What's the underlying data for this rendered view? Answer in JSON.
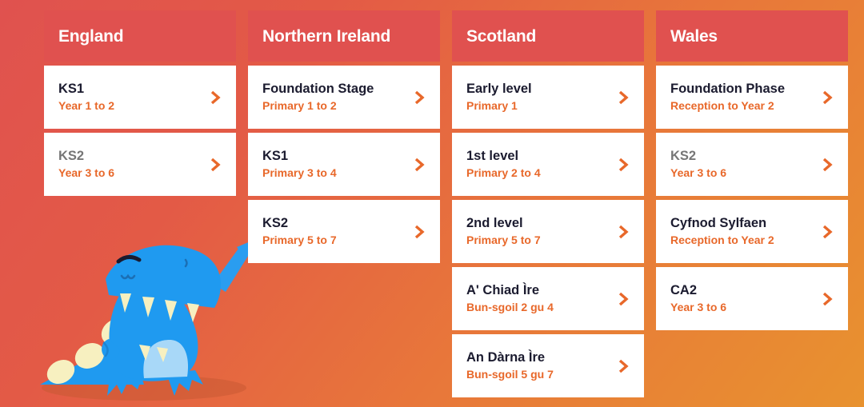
{
  "theme": {
    "background_start": "#e0524f",
    "background_end": "#e8922f",
    "header_bg": "#e0514f",
    "card_bg": "#ffffff",
    "title_color": "#1b1b2f",
    "title_muted_color": "#767676",
    "subtitle_color": "#e8682a",
    "chevron_color": "#e8682a",
    "mascot_body_color": "#1f9af0",
    "mascot_belly_color": "#a8d8f8",
    "mascot_spike_color": "#f7f0c0",
    "mascot_tooth_color": "#f7f0c0"
  },
  "mascot": {
    "name": "blue-dinosaur-mascot",
    "description": "blue cartoon dinosaur with open mouth, cream teeth, cream back spikes and a raised pointing arm"
  },
  "columns": [
    {
      "id": "england",
      "header": "England",
      "cards": [
        {
          "title": "KS1",
          "subtitle": "Year 1 to 2",
          "muted": false,
          "chevron": "chevron-right-icon"
        },
        {
          "title": "KS2",
          "subtitle": "Year 3 to 6",
          "muted": true,
          "chevron": "chevron-right-icon"
        }
      ]
    },
    {
      "id": "northern-ireland",
      "header": "Northern Ireland",
      "cards": [
        {
          "title": "Foundation Stage",
          "subtitle": "Primary 1 to 2",
          "muted": false,
          "chevron": "chevron-right-icon"
        },
        {
          "title": "KS1",
          "subtitle": "Primary 3 to 4",
          "muted": false,
          "chevron": "chevron-right-icon"
        },
        {
          "title": "KS2",
          "subtitle": "Primary 5 to 7",
          "muted": false,
          "chevron": "chevron-right-icon"
        }
      ]
    },
    {
      "id": "scotland",
      "header": "Scotland",
      "cards": [
        {
          "title": "Early level",
          "subtitle": "Primary 1",
          "muted": false,
          "chevron": "chevron-right-icon"
        },
        {
          "title": "1st level",
          "subtitle": "Primary 2 to 4",
          "muted": false,
          "chevron": "chevron-right-icon"
        },
        {
          "title": "2nd level",
          "subtitle": "Primary 5 to 7",
          "muted": false,
          "chevron": "chevron-right-icon"
        },
        {
          "title": "A' Chiad Ìre",
          "subtitle": "Bun-sgoil 2 gu 4",
          "muted": false,
          "chevron": "chevron-right-icon"
        },
        {
          "title": "An Dàrna Ìre",
          "subtitle": "Bun-sgoil 5 gu 7",
          "muted": false,
          "chevron": "chevron-right-icon"
        }
      ]
    },
    {
      "id": "wales",
      "header": "Wales",
      "cards": [
        {
          "title": "Foundation Phase",
          "subtitle": "Reception to Year 2",
          "muted": false,
          "chevron": "chevron-right-icon"
        },
        {
          "title": "KS2",
          "subtitle": "Year 3 to 6",
          "muted": true,
          "chevron": "chevron-right-icon"
        },
        {
          "title": "Cyfnod Sylfaen",
          "subtitle": "Reception to Year 2",
          "muted": false,
          "chevron": "chevron-right-icon"
        },
        {
          "title": "CA2",
          "subtitle": "Year 3 to 6",
          "muted": false,
          "chevron": "chevron-right-icon"
        }
      ]
    }
  ]
}
